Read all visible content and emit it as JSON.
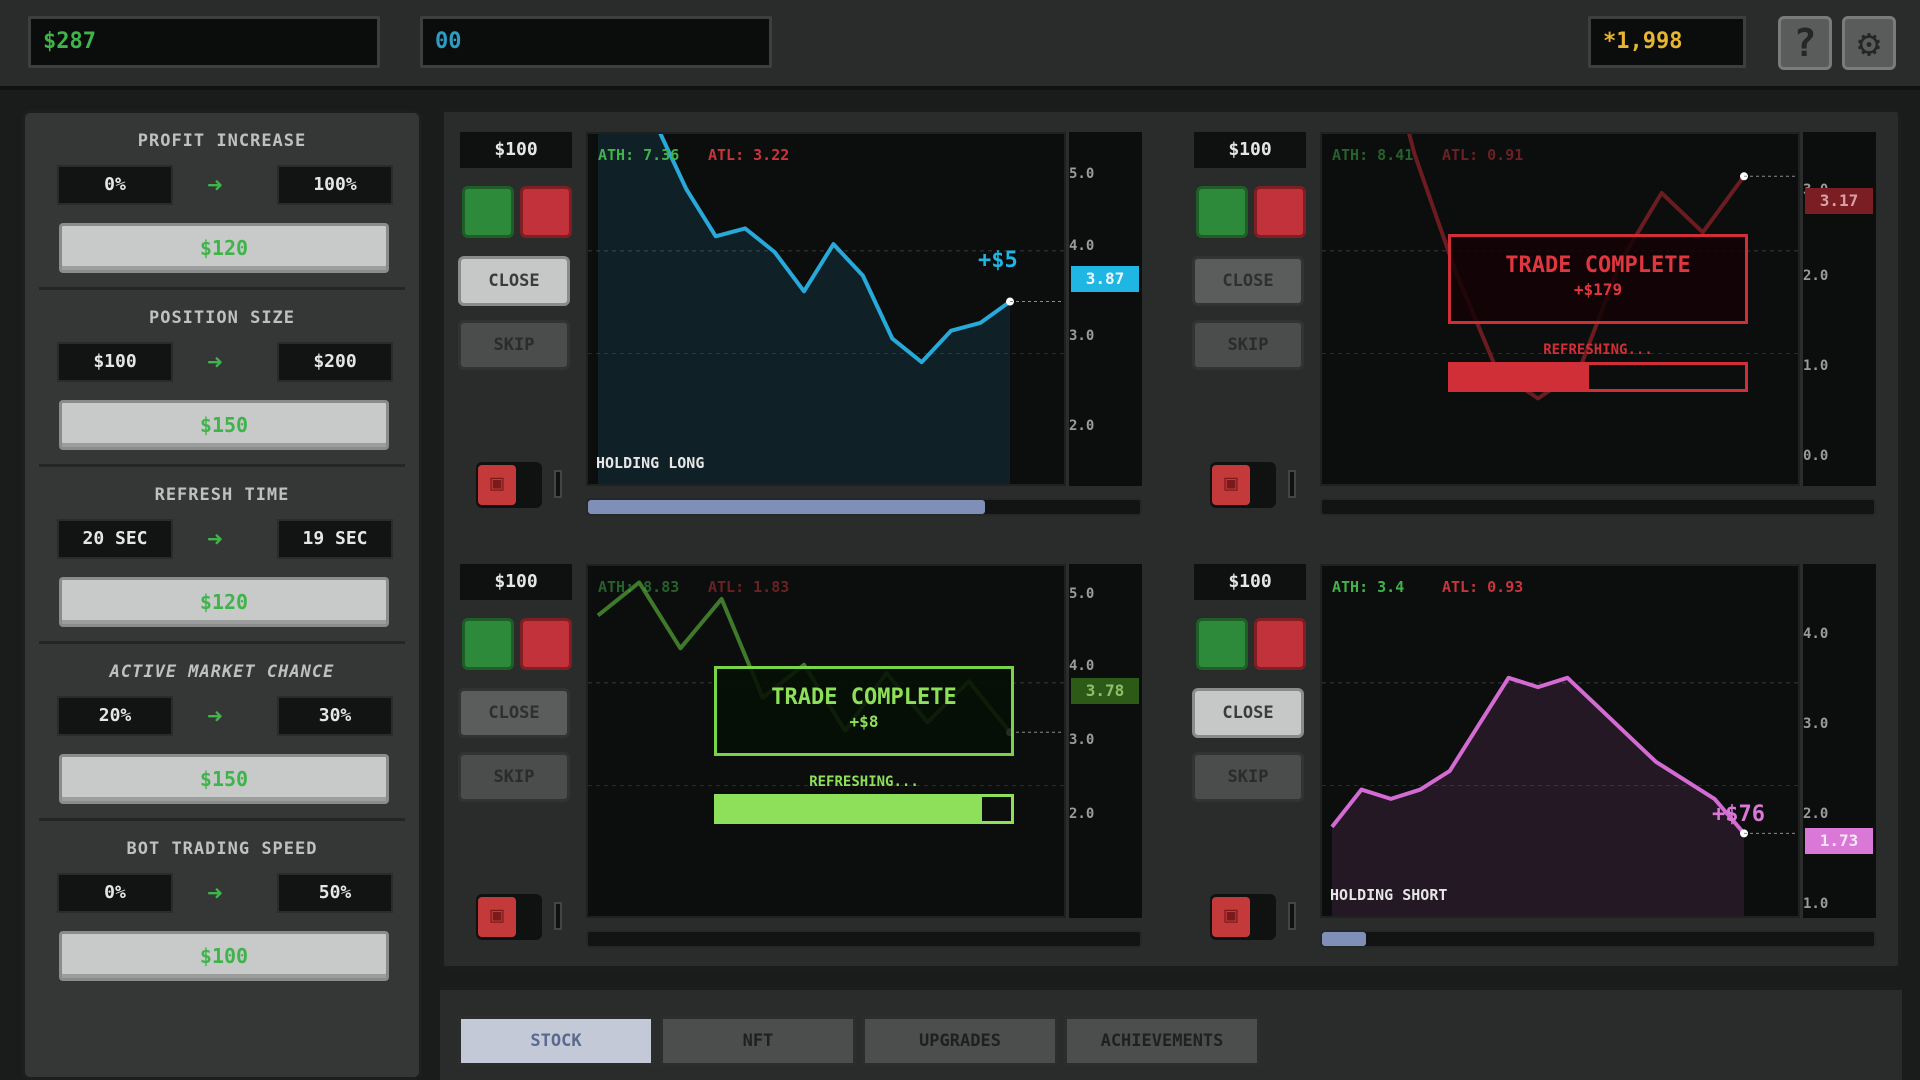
{
  "topbar": {
    "money": "$287",
    "gems": "00",
    "score": "*1,998",
    "help_icon": "question-mark-icon",
    "settings_icon": "gear-icon"
  },
  "upgrades": [
    {
      "title": "PROFIT INCREASE",
      "from": "0%",
      "to": "100%",
      "price": "$120"
    },
    {
      "title": "POSITION SIZE",
      "from": "$100",
      "to": "$200",
      "price": "$150"
    },
    {
      "title": "REFRESH TIME",
      "from": "20 SEC",
      "to": "19 SEC",
      "price": "$120"
    },
    {
      "title": "ACTIVE MARKET CHANCE",
      "from": "20%",
      "to": "30%",
      "price": "$150"
    },
    {
      "title": "BOT TRADING SPEED",
      "from": "0%",
      "to": "50%",
      "price": "$100"
    }
  ],
  "markets": [
    {
      "bet": "$100",
      "close": "CLOSE",
      "skip": "SKIP",
      "ath": "ATH: 7.36",
      "atl": "ATL: 3.22",
      "status": "HOLDING LONG",
      "gain": "+$5",
      "price": "3.87",
      "price_color": "#1fb6e3",
      "line_color": "#27a9da",
      "ticks": [
        "5.0",
        "4.0",
        "3.0",
        "2.0"
      ],
      "progress": 0.72,
      "chart_data": {
        "type": "line",
        "y": [
          7.2,
          6.8,
          6.1,
          5.3,
          4.7,
          4.8,
          4.5,
          4.0,
          4.6,
          4.2,
          3.4,
          3.1,
          3.5,
          3.6,
          3.87
        ],
        "ylim": [
          1.5,
          6.0
        ]
      }
    },
    {
      "bet": "$100",
      "close": "CLOSE",
      "skip": "SKIP",
      "ath": "ATH: 8.41",
      "atl": "ATL: 0.91",
      "complete_title": "TRADE COMPLETE",
      "complete_amount": "+$179",
      "refreshing": "REFRESHING...",
      "refresh_progress": 0.47,
      "price": "3.17",
      "price_color": "#8a2a2e",
      "line_color": "#6b1c20",
      "ticks": [
        "3.0",
        "2.0",
        "1.0",
        "0.0"
      ],
      "progress": 0.0,
      "chart_data": {
        "type": "line",
        "y": [
          8.4,
          5.0,
          3.4,
          2.2,
          1.2,
          0.91,
          1.2,
          2.3,
          3.0,
          2.6,
          3.17
        ],
        "ylim": [
          0.0,
          3.6
        ]
      }
    },
    {
      "bet": "$100",
      "close": "CLOSE",
      "skip": "SKIP",
      "ath": "ATH: 8.83",
      "atl": "ATL: 1.83",
      "complete_title": "TRADE COMPLETE",
      "complete_amount": "+$8",
      "refreshing": "REFRESHING...",
      "refresh_progress": 0.9,
      "price": "3.78",
      "price_color": "#3c6e1f",
      "line_color": "#3e7a2a",
      "ticks": [
        "5.0",
        "4.0",
        "3.0",
        "2.0"
      ],
      "progress": 0.0,
      "chart_data": {
        "type": "line",
        "y": [
          5.2,
          5.6,
          4.8,
          5.4,
          4.2,
          4.6,
          3.8,
          4.5,
          3.9,
          4.4,
          3.78
        ],
        "ylim": [
          1.5,
          5.8
        ]
      }
    },
    {
      "bet": "$100",
      "close": "CLOSE",
      "skip": "SKIP",
      "ath": "ATH: 3.4",
      "atl": "ATL: 0.93",
      "status": "HOLDING SHORT",
      "gain": "+$76",
      "price": "1.73",
      "price_color": "#d978d6",
      "line_color": "#d36bd2",
      "ticks": [
        "4.0",
        "3.0",
        "2.0",
        "1.0"
      ],
      "progress": 0.08,
      "chart_data": {
        "type": "line",
        "y": [
          1.8,
          2.2,
          2.1,
          2.2,
          2.4,
          2.9,
          3.4,
          3.3,
          3.4,
          3.1,
          2.8,
          2.5,
          2.3,
          2.1,
          1.73
        ],
        "ylim": [
          0.8,
          4.6
        ]
      }
    }
  ],
  "tabs": [
    {
      "label": "STOCK",
      "selected": true
    },
    {
      "label": "NFT",
      "selected": false
    },
    {
      "label": "UPGRADES",
      "selected": false
    },
    {
      "label": "ACHIEVEMENTS",
      "selected": false
    }
  ]
}
